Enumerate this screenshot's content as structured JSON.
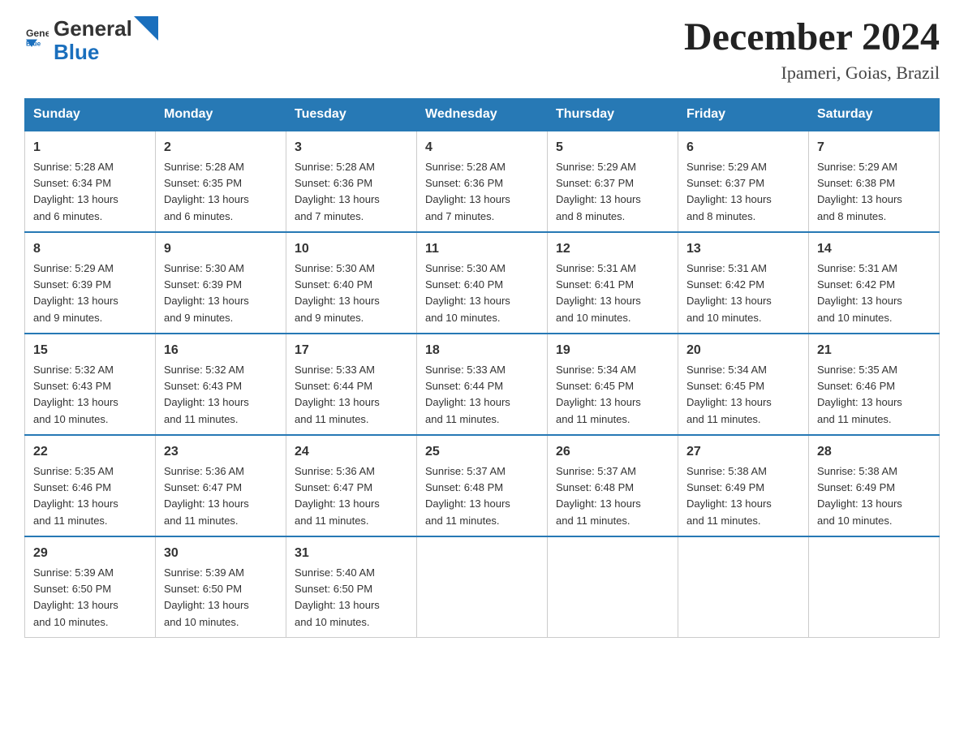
{
  "header": {
    "logo_text_general": "General",
    "logo_text_blue": "Blue",
    "title": "December 2024",
    "subtitle": "Ipameri, Goias, Brazil"
  },
  "calendar": {
    "headers": [
      "Sunday",
      "Monday",
      "Tuesday",
      "Wednesday",
      "Thursday",
      "Friday",
      "Saturday"
    ],
    "weeks": [
      [
        {
          "day": "1",
          "sunrise": "5:28 AM",
          "sunset": "6:34 PM",
          "daylight": "13 hours and 6 minutes."
        },
        {
          "day": "2",
          "sunrise": "5:28 AM",
          "sunset": "6:35 PM",
          "daylight": "13 hours and 6 minutes."
        },
        {
          "day": "3",
          "sunrise": "5:28 AM",
          "sunset": "6:36 PM",
          "daylight": "13 hours and 7 minutes."
        },
        {
          "day": "4",
          "sunrise": "5:28 AM",
          "sunset": "6:36 PM",
          "daylight": "13 hours and 7 minutes."
        },
        {
          "day": "5",
          "sunrise": "5:29 AM",
          "sunset": "6:37 PM",
          "daylight": "13 hours and 8 minutes."
        },
        {
          "day": "6",
          "sunrise": "5:29 AM",
          "sunset": "6:37 PM",
          "daylight": "13 hours and 8 minutes."
        },
        {
          "day": "7",
          "sunrise": "5:29 AM",
          "sunset": "6:38 PM",
          "daylight": "13 hours and 8 minutes."
        }
      ],
      [
        {
          "day": "8",
          "sunrise": "5:29 AM",
          "sunset": "6:39 PM",
          "daylight": "13 hours and 9 minutes."
        },
        {
          "day": "9",
          "sunrise": "5:30 AM",
          "sunset": "6:39 PM",
          "daylight": "13 hours and 9 minutes."
        },
        {
          "day": "10",
          "sunrise": "5:30 AM",
          "sunset": "6:40 PM",
          "daylight": "13 hours and 9 minutes."
        },
        {
          "day": "11",
          "sunrise": "5:30 AM",
          "sunset": "6:40 PM",
          "daylight": "13 hours and 10 minutes."
        },
        {
          "day": "12",
          "sunrise": "5:31 AM",
          "sunset": "6:41 PM",
          "daylight": "13 hours and 10 minutes."
        },
        {
          "day": "13",
          "sunrise": "5:31 AM",
          "sunset": "6:42 PM",
          "daylight": "13 hours and 10 minutes."
        },
        {
          "day": "14",
          "sunrise": "5:31 AM",
          "sunset": "6:42 PM",
          "daylight": "13 hours and 10 minutes."
        }
      ],
      [
        {
          "day": "15",
          "sunrise": "5:32 AM",
          "sunset": "6:43 PM",
          "daylight": "13 hours and 10 minutes."
        },
        {
          "day": "16",
          "sunrise": "5:32 AM",
          "sunset": "6:43 PM",
          "daylight": "13 hours and 11 minutes."
        },
        {
          "day": "17",
          "sunrise": "5:33 AM",
          "sunset": "6:44 PM",
          "daylight": "13 hours and 11 minutes."
        },
        {
          "day": "18",
          "sunrise": "5:33 AM",
          "sunset": "6:44 PM",
          "daylight": "13 hours and 11 minutes."
        },
        {
          "day": "19",
          "sunrise": "5:34 AM",
          "sunset": "6:45 PM",
          "daylight": "13 hours and 11 minutes."
        },
        {
          "day": "20",
          "sunrise": "5:34 AM",
          "sunset": "6:45 PM",
          "daylight": "13 hours and 11 minutes."
        },
        {
          "day": "21",
          "sunrise": "5:35 AM",
          "sunset": "6:46 PM",
          "daylight": "13 hours and 11 minutes."
        }
      ],
      [
        {
          "day": "22",
          "sunrise": "5:35 AM",
          "sunset": "6:46 PM",
          "daylight": "13 hours and 11 minutes."
        },
        {
          "day": "23",
          "sunrise": "5:36 AM",
          "sunset": "6:47 PM",
          "daylight": "13 hours and 11 minutes."
        },
        {
          "day": "24",
          "sunrise": "5:36 AM",
          "sunset": "6:47 PM",
          "daylight": "13 hours and 11 minutes."
        },
        {
          "day": "25",
          "sunrise": "5:37 AM",
          "sunset": "6:48 PM",
          "daylight": "13 hours and 11 minutes."
        },
        {
          "day": "26",
          "sunrise": "5:37 AM",
          "sunset": "6:48 PM",
          "daylight": "13 hours and 11 minutes."
        },
        {
          "day": "27",
          "sunrise": "5:38 AM",
          "sunset": "6:49 PM",
          "daylight": "13 hours and 11 minutes."
        },
        {
          "day": "28",
          "sunrise": "5:38 AM",
          "sunset": "6:49 PM",
          "daylight": "13 hours and 10 minutes."
        }
      ],
      [
        {
          "day": "29",
          "sunrise": "5:39 AM",
          "sunset": "6:50 PM",
          "daylight": "13 hours and 10 minutes."
        },
        {
          "day": "30",
          "sunrise": "5:39 AM",
          "sunset": "6:50 PM",
          "daylight": "13 hours and 10 minutes."
        },
        {
          "day": "31",
          "sunrise": "5:40 AM",
          "sunset": "6:50 PM",
          "daylight": "13 hours and 10 minutes."
        },
        null,
        null,
        null,
        null
      ]
    ],
    "label_sunrise": "Sunrise:",
    "label_sunset": "Sunset:",
    "label_daylight": "Daylight:"
  }
}
